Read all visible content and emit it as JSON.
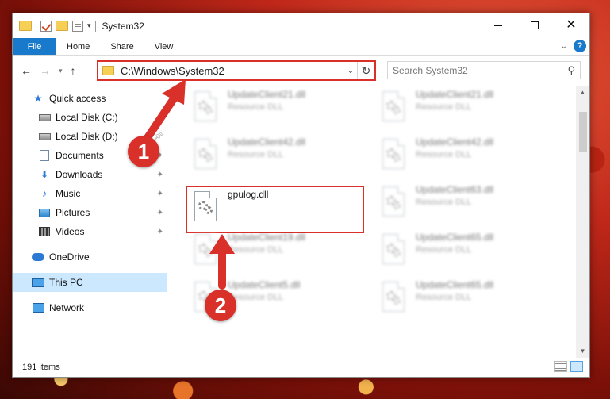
{
  "window": {
    "title": "System32"
  },
  "ribbon": {
    "tabs": [
      "File",
      "Home",
      "Share",
      "View"
    ],
    "help": "?"
  },
  "address": {
    "path": "C:\\Windows\\System32"
  },
  "search": {
    "placeholder": "Search System32"
  },
  "sidebar": {
    "quick_access": "Quick access",
    "items": [
      {
        "label": "Local Disk (C:)",
        "icon": "disk-icon",
        "pinned": false
      },
      {
        "label": "Local Disk (D:)",
        "icon": "disk-icon",
        "pinned": true
      },
      {
        "label": "Documents",
        "icon": "documents-icon",
        "pinned": true
      },
      {
        "label": "Downloads",
        "icon": "downloads-icon",
        "pinned": true
      },
      {
        "label": "Music",
        "icon": "music-icon",
        "pinned": true
      },
      {
        "label": "Pictures",
        "icon": "pictures-icon",
        "pinned": true
      },
      {
        "label": "Videos",
        "icon": "videos-icon",
        "pinned": true
      }
    ],
    "onedrive": "OneDrive",
    "this_pc": "This PC",
    "network": "Network"
  },
  "files": [
    {
      "name": "UpdateClient21.dll",
      "type": "Resource DLL"
    },
    {
      "name": "UpdateClient21.dll",
      "type": "Resource DLL"
    },
    {
      "name": "UpdateClient42.dll",
      "type": "Resource DLL"
    },
    {
      "name": "UpdateClient42.dll",
      "type": "Resource DLL"
    },
    {
      "name": "gpulog.dll",
      "type": ""
    },
    {
      "name": "UpdateClient63.dll",
      "type": "Resource DLL"
    },
    {
      "name": "UpdateClient19.dll",
      "type": "Resource DLL"
    },
    {
      "name": "UpdateClient65.dll",
      "type": "Resource DLL"
    },
    {
      "name": "UpdateClient5.dll",
      "type": "Resource DLL"
    },
    {
      "name": "UpdateClient65.dll",
      "type": "Resource DLL"
    }
  ],
  "status": {
    "count": "191 items"
  },
  "annotations": {
    "step1": "1",
    "step2": "2",
    "color": "#d9302a"
  }
}
